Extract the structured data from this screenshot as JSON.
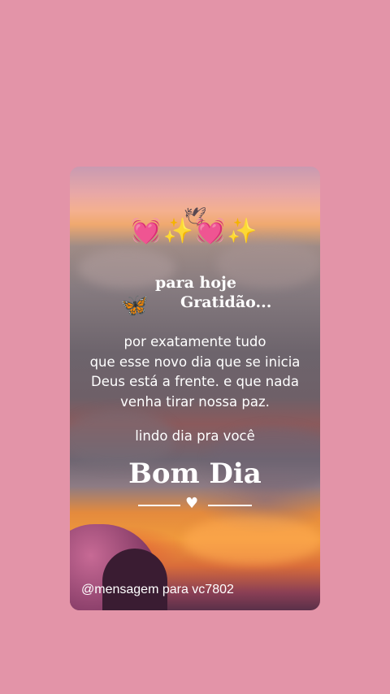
{
  "card": {
    "emoji_line": "💓✨💓✨",
    "bird_icon": "bird-icon",
    "title_line1": "para hoje",
    "title_line2": "Gratidão...",
    "butterfly_icon": "butterfly-icon",
    "message_lines": [
      "por exatamente tudo",
      "que esse novo dia que se inicia",
      "Deus está a frente. e que nada",
      "venha tirar nossa paz."
    ],
    "closing": "lindo dia pra você",
    "headline": "Bom Dia",
    "divider_icon": "heart-icon",
    "watermark": "@mensagem para vc7802"
  },
  "colors": {
    "background": "#e394a8",
    "text": "#ffffff",
    "sunset_orange": "#f09a3c"
  }
}
